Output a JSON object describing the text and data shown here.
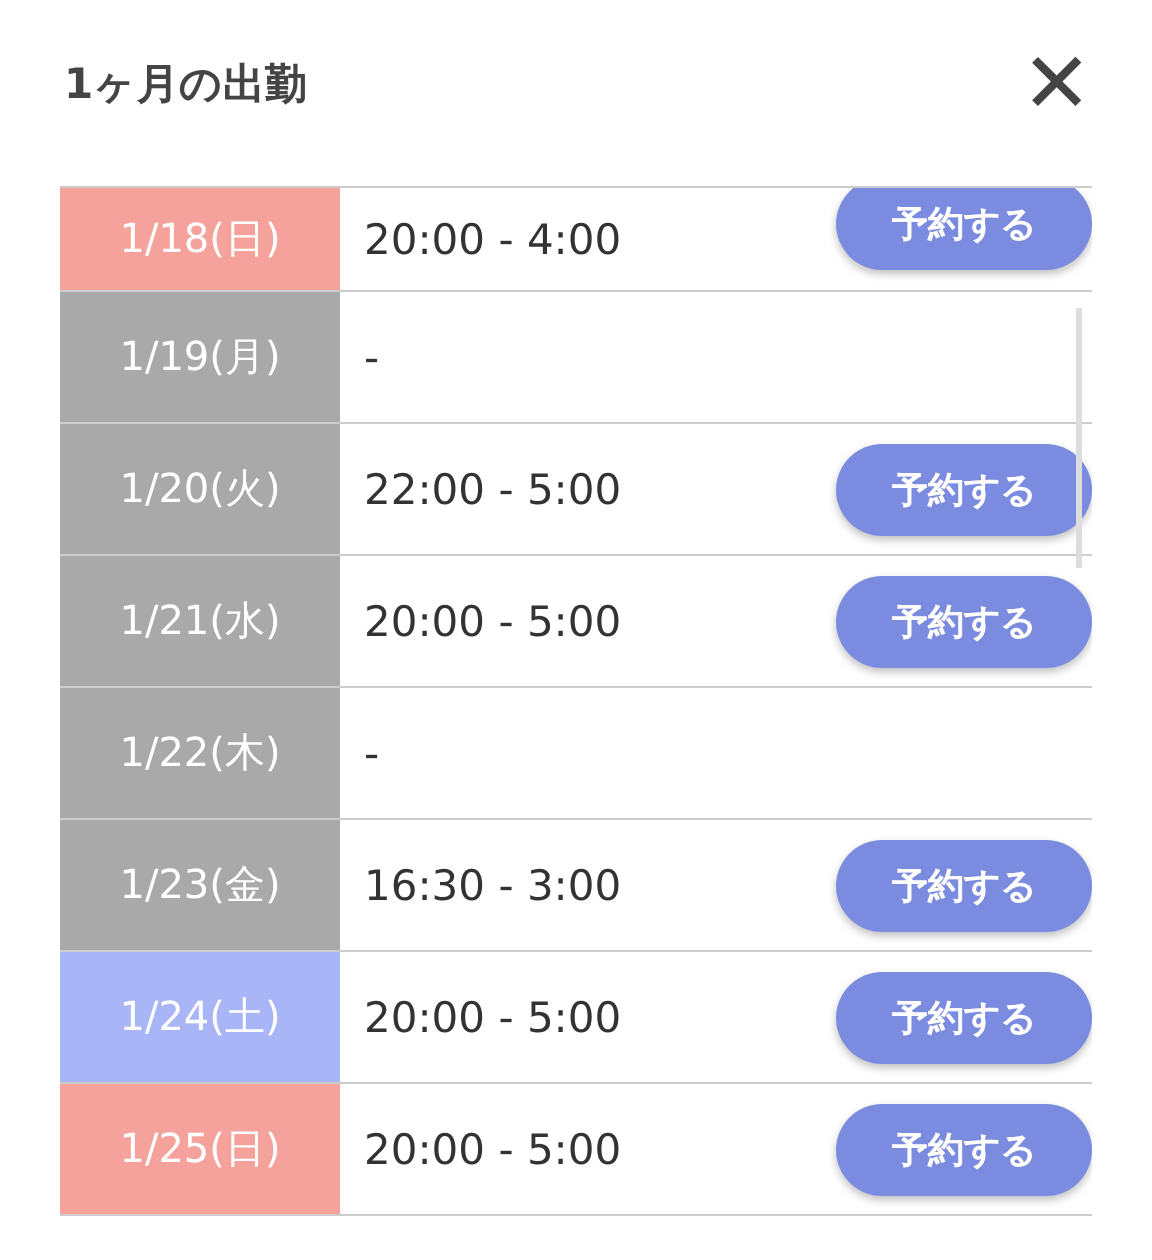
{
  "title": "1ヶ月の出勤",
  "close": "✕",
  "rows": [
    {
      "date": "1/18(日)",
      "kind": "sunday",
      "time": "20:00 - 4:00",
      "button": "予約する"
    },
    {
      "date": "1/19(月)",
      "kind": "weekday",
      "time": "-"
    },
    {
      "date": "1/20(火)",
      "kind": "weekday",
      "time": "22:00 - 5:00",
      "button": "予約する"
    },
    {
      "date": "1/21(水)",
      "kind": "weekday",
      "time": "20:00 - 5:00",
      "button": "予約する"
    },
    {
      "date": "1/22(木)",
      "kind": "weekday",
      "time": "-"
    },
    {
      "date": "1/23(金)",
      "kind": "weekday",
      "time": "16:30 - 3:00",
      "button": "予約する"
    },
    {
      "date": "1/24(土)",
      "kind": "saturday",
      "time": "20:00 - 5:00",
      "button": "予約する"
    },
    {
      "date": "1/25(日)",
      "kind": "sunday",
      "time": "20:00 - 5:00",
      "button": "予約する"
    }
  ]
}
